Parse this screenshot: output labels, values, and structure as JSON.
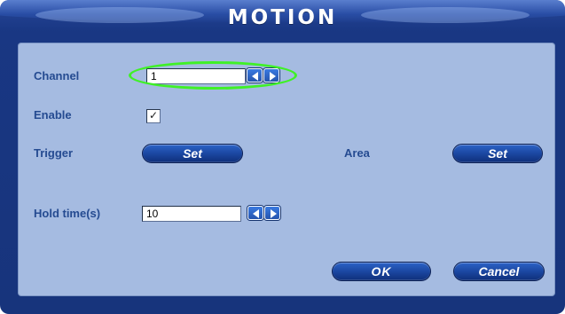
{
  "dialog": {
    "title": "MOTION"
  },
  "fields": {
    "channel": {
      "label": "Channel",
      "value": "1"
    },
    "enable": {
      "label": "Enable",
      "checked": true,
      "check_glyph": "✓"
    },
    "trigger": {
      "label": "Trigger",
      "button_label": "Set"
    },
    "area": {
      "label": "Area",
      "button_label": "Set"
    },
    "hold_time": {
      "label": "Hold time(s)",
      "value": "10"
    }
  },
  "actions": {
    "ok_label": "OK",
    "cancel_label": "Cancel"
  },
  "icons": {
    "left_arrow": "arrow-left-icon",
    "right_arrow": "arrow-right-icon",
    "highlight": "highlight-oval"
  },
  "colors": {
    "dialog_blue": "#17347c",
    "panel_blue": "#a5bbe1",
    "label_blue": "#254b91",
    "button_blue": "#1b46a0",
    "highlight_green": "#3ff126"
  }
}
